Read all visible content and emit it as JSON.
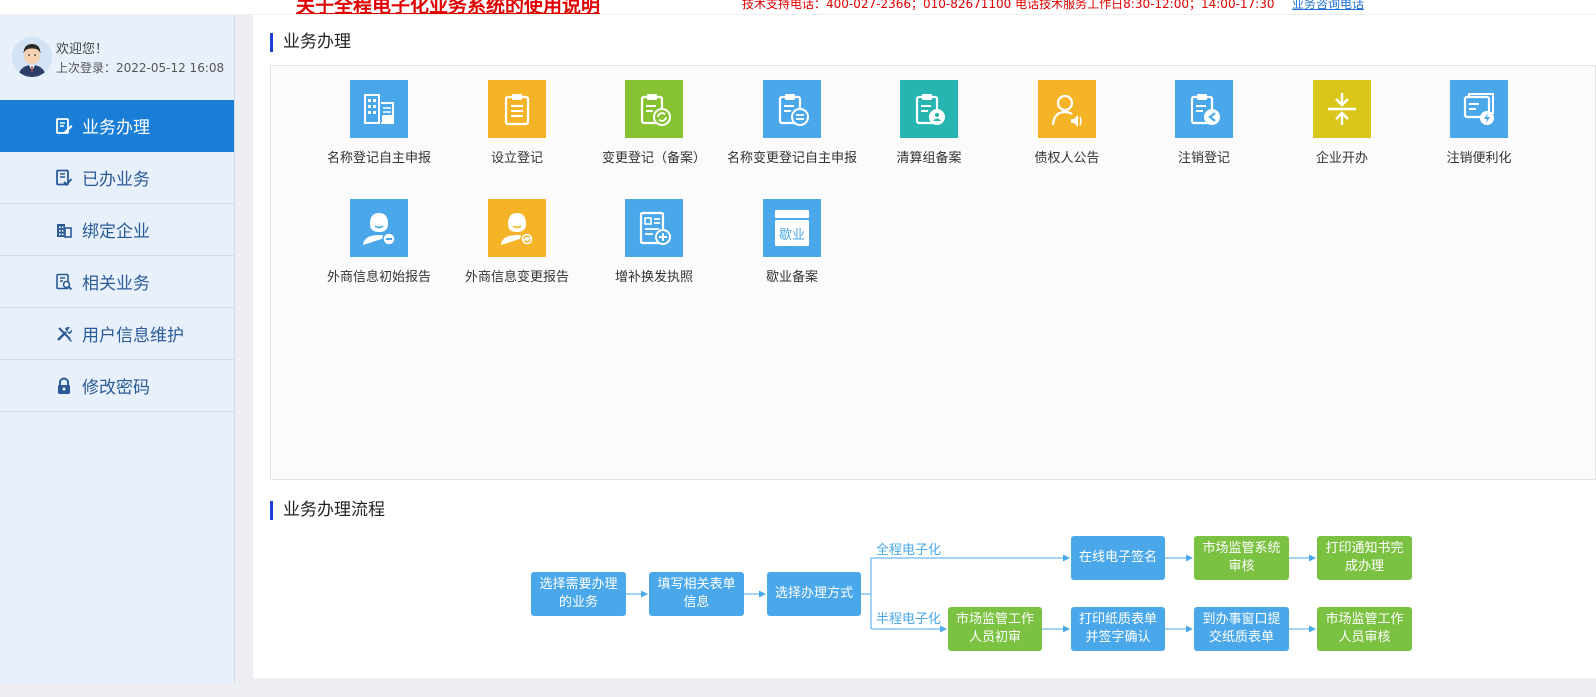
{
  "top_notice": {
    "title": "关于全程电子化业务系统的使用说明",
    "phone_text": "技术支持电话：400-027-2366；010-82671100 电话技术服务工作日8:30-12:00；14:00-17:30",
    "link_text": "业务咨询电话"
  },
  "user": {
    "welcome": "欢迎您！",
    "last_login": "上次登录：2022-05-12 16:08"
  },
  "sidebar": {
    "items": [
      {
        "label": "业务办理",
        "icon": "edit-doc-icon"
      },
      {
        "label": "已办业务",
        "icon": "doc-check-icon"
      },
      {
        "label": "绑定企业",
        "icon": "building-icon"
      },
      {
        "label": "相关业务",
        "icon": "doc-search-icon"
      },
      {
        "label": "用户信息维护",
        "icon": "tools-icon"
      },
      {
        "label": "修改密码",
        "icon": "lock-icon"
      }
    ]
  },
  "business": {
    "title": "业务办理",
    "tiles": [
      {
        "label": "名称登记自主申报",
        "icon": "building-report-icon",
        "color": "#4aa8ea"
      },
      {
        "label": "设立登记",
        "icon": "clipboard-icon",
        "color": "#f5b428"
      },
      {
        "label": "变更登记（备案）",
        "icon": "clipboard-refresh-icon",
        "color": "#86c232"
      },
      {
        "label": "名称变更登记自主申报",
        "icon": "clipboard-swap-icon",
        "color": "#4aa8ea"
      },
      {
        "label": "清算组备案",
        "icon": "clipboard-group-icon",
        "color": "#26b5b0"
      },
      {
        "label": "债权人公告",
        "icon": "person-speaker-icon",
        "color": "#f5b428"
      },
      {
        "label": "注销登记",
        "icon": "clipboard-back-icon",
        "color": "#4aa8ea"
      },
      {
        "label": "企业开办",
        "icon": "compress-icon",
        "color": "#d9c61a"
      },
      {
        "label": "注销便利化",
        "icon": "document-lightning-icon",
        "color": "#4aa8ea"
      },
      {
        "label": "外商信息初始报告",
        "icon": "foreign-person-minus-icon",
        "color": "#4aa8ea"
      },
      {
        "label": "外商信息变更报告",
        "icon": "foreign-person-refresh-icon",
        "color": "#f5b428"
      },
      {
        "label": "增补换发执照",
        "icon": "license-add-icon",
        "color": "#4aa8ea"
      },
      {
        "label": "歇业备案",
        "icon": "closed-shop-icon",
        "color": "#4aa8ea",
        "icon_text": "歇业"
      }
    ]
  },
  "process": {
    "title": "业务办理流程",
    "full_label": "全程电子化",
    "half_label": "半程电子化",
    "steps": {
      "s1": "选择需要办理的业务",
      "s2": "填写相关表单信息",
      "s3": "选择办理方式",
      "f1": "在线电子签名",
      "f2": "市场监管系统审核",
      "f3": "打印通知书完成办理",
      "h1": "市场监管工作人员初审",
      "h2": "打印纸质表单并签字确认",
      "h3": "到办事窗口提交纸质表单",
      "h4": "市场监管工作人员审核"
    }
  }
}
